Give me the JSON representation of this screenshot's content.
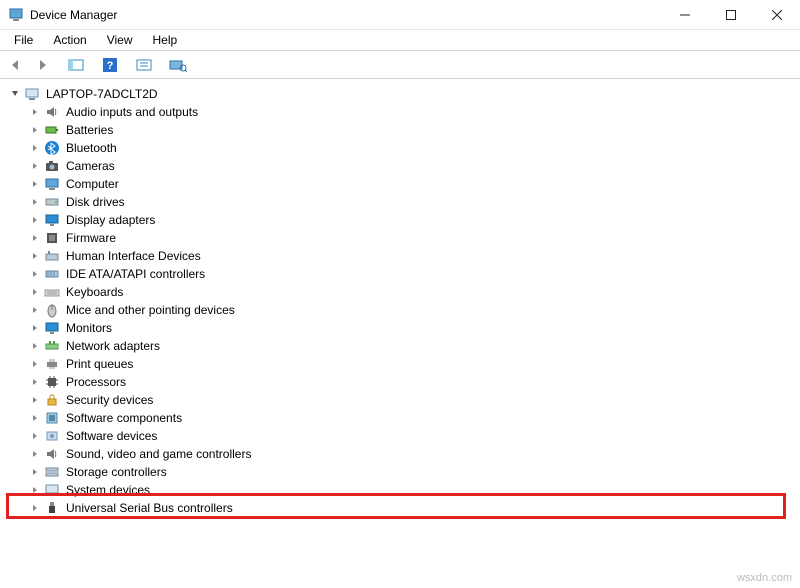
{
  "window": {
    "title": "Device Manager"
  },
  "menu": {
    "file": "File",
    "action": "Action",
    "view": "View",
    "help": "Help"
  },
  "tree": {
    "root": "LAPTOP-7ADCLT2D",
    "items": [
      {
        "label": "Audio inputs and outputs",
        "icon": "audio"
      },
      {
        "label": "Batteries",
        "icon": "battery"
      },
      {
        "label": "Bluetooth",
        "icon": "bluetooth"
      },
      {
        "label": "Cameras",
        "icon": "camera"
      },
      {
        "label": "Computer",
        "icon": "computer"
      },
      {
        "label": "Disk drives",
        "icon": "disk"
      },
      {
        "label": "Display adapters",
        "icon": "display"
      },
      {
        "label": "Firmware",
        "icon": "firmware"
      },
      {
        "label": "Human Interface Devices",
        "icon": "hid"
      },
      {
        "label": "IDE ATA/ATAPI controllers",
        "icon": "ide"
      },
      {
        "label": "Keyboards",
        "icon": "keyboard"
      },
      {
        "label": "Mice and other pointing devices",
        "icon": "mouse"
      },
      {
        "label": "Monitors",
        "icon": "monitor"
      },
      {
        "label": "Network adapters",
        "icon": "network"
      },
      {
        "label": "Print queues",
        "icon": "printer"
      },
      {
        "label": "Processors",
        "icon": "cpu"
      },
      {
        "label": "Security devices",
        "icon": "security"
      },
      {
        "label": "Software components",
        "icon": "swcomp"
      },
      {
        "label": "Software devices",
        "icon": "swdev"
      },
      {
        "label": "Sound, video and game controllers",
        "icon": "sound"
      },
      {
        "label": "Storage controllers",
        "icon": "storage"
      },
      {
        "label": "System devices",
        "icon": "system"
      },
      {
        "label": "Universal Serial Bus controllers",
        "icon": "usb"
      }
    ]
  },
  "highlighted_index": 22,
  "watermark": "wsxdn.com"
}
